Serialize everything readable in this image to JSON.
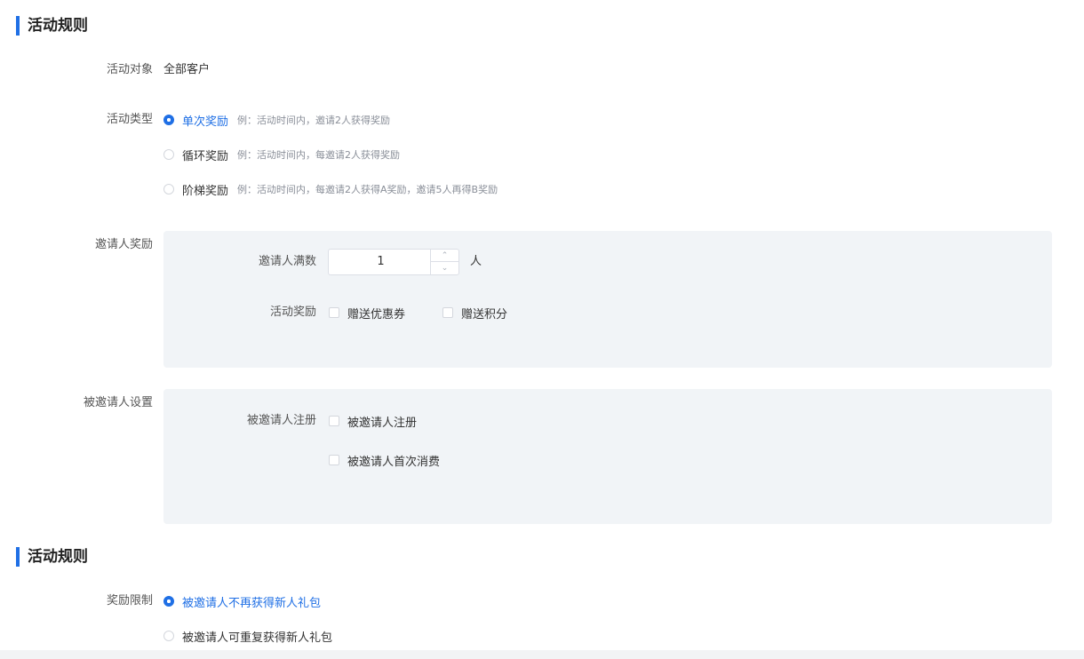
{
  "section1": {
    "title": "活动规则"
  },
  "target": {
    "label": "活动对象",
    "value": "全部客户"
  },
  "type": {
    "label": "活动类型",
    "options": [
      {
        "label": "单次奖励",
        "hint": "例：活动时间内，邀请2人获得奖励",
        "selected": true
      },
      {
        "label": "循环奖励",
        "hint": "例：活动时间内，每邀请2人获得奖励",
        "selected": false
      },
      {
        "label": "阶梯奖励",
        "hint": "例：活动时间内，每邀请2人获得A奖励，邀请5人再得B奖励",
        "selected": false
      }
    ]
  },
  "inviter": {
    "label": "邀请人奖励",
    "count_label": "邀请人满数",
    "count_value": "1",
    "unit": "人",
    "reward_label": "活动奖励",
    "rewards": [
      "赠送优惠券",
      "赠送积分"
    ]
  },
  "invitee": {
    "label": "被邀请人设置",
    "register_label": "被邀请人注册",
    "options": [
      "被邀请人注册",
      "被邀请人首次消费"
    ]
  },
  "section2": {
    "title": "活动规则"
  },
  "limit": {
    "label": "奖励限制",
    "options": [
      {
        "label": "被邀请人不再获得新人礼包",
        "selected": true
      },
      {
        "label": "被邀请人可重复获得新人礼包",
        "selected": false
      }
    ]
  },
  "colors": {
    "accent": "#1f6fe5",
    "panel": "#f1f4f7"
  }
}
